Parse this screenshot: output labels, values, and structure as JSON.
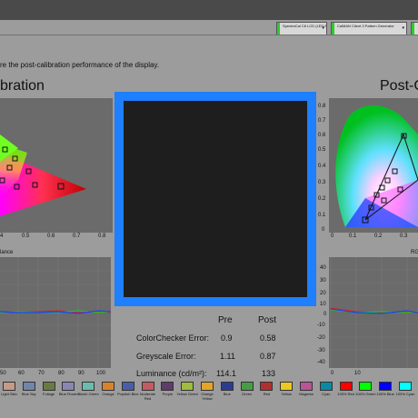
{
  "toolbar": {
    "meter_select": "SpectraCal C6 LCD (LED RGB)",
    "generator_select": "CalMAN Client 3 Pattern Generator"
  },
  "intro_text": "re the post-calibration performance of the display.",
  "left_heading": "bration",
  "right_heading": "Post-C",
  "left_cie": {
    "x_ticks": [
      "4",
      "0.5",
      "0.6",
      "0.7",
      "0.8"
    ],
    "panel_label": "lance"
  },
  "right_cie": {
    "y_ticks": [
      "0.8",
      "0.7",
      "0.6",
      "0.5",
      "0.4",
      "0.3",
      "0.2",
      "0.1",
      "0"
    ],
    "x_ticks": [
      "0",
      "0.1",
      "0.2",
      "0.3"
    ],
    "panel_label": "RG"
  },
  "left_balance": {
    "x_ticks": [
      "50",
      "60",
      "70",
      "80",
      "90",
      "100"
    ]
  },
  "right_balance": {
    "y_ticks": [
      "40",
      "30",
      "20",
      "10",
      "0",
      "-10",
      "-20",
      "-30",
      "-40"
    ],
    "x_ticks": [
      "0",
      "10"
    ]
  },
  "stats": {
    "col_pre": "Pre",
    "col_post": "Post",
    "rows": [
      {
        "label": "ColorChecker Error:",
        "pre": "0.9",
        "post": "0.58"
      },
      {
        "label": "Greyscale Error:",
        "pre": "1.11",
        "post": "0.87"
      },
      {
        "label": "Luminance (cd/m²):",
        "pre": "114.1",
        "post": "133"
      }
    ]
  },
  "swatches": [
    {
      "label": "Light Skin",
      "color": "#c49a88"
    },
    {
      "label": "Blue Sky",
      "color": "#6f86a8"
    },
    {
      "label": "Foliage",
      "color": "#6a7a45"
    },
    {
      "label": "Blue Flower",
      "color": "#8a86b2"
    },
    {
      "label": "Bluish Green",
      "color": "#6cbcae"
    },
    {
      "label": "Orange",
      "color": "#d9822e"
    },
    {
      "label": "Purplish Blue",
      "color": "#4a5ea8"
    },
    {
      "label": "Moderate Red",
      "color": "#c45a62"
    },
    {
      "label": "Purple",
      "color": "#5e3c6c"
    },
    {
      "label": "Yellow Green",
      "color": "#a0bc3e"
    },
    {
      "label": "Orange Yellow",
      "color": "#e4a42c"
    },
    {
      "label": "Blue",
      "color": "#2e3c90"
    },
    {
      "label": "Green",
      "color": "#489c48"
    },
    {
      "label": "Red",
      "color": "#b0302e"
    },
    {
      "label": "Yellow",
      "color": "#eec81e"
    },
    {
      "label": "Magenta",
      "color": "#ba5496"
    },
    {
      "label": "Cyan",
      "color": "#088aa4"
    },
    {
      "label": "100% Red",
      "color": "#ff0000"
    },
    {
      "label": "100% Green",
      "color": "#00ff00"
    },
    {
      "label": "100% Blue",
      "color": "#0000ff"
    },
    {
      "label": "100% Cyan",
      "color": "#00ffff"
    }
  ],
  "colors": {
    "accent_blue": "#1e7fff",
    "preview_fill": "#1e1e1e",
    "panel_bg": "#6b6b6b",
    "page_bg": "#9c9c9c"
  }
}
